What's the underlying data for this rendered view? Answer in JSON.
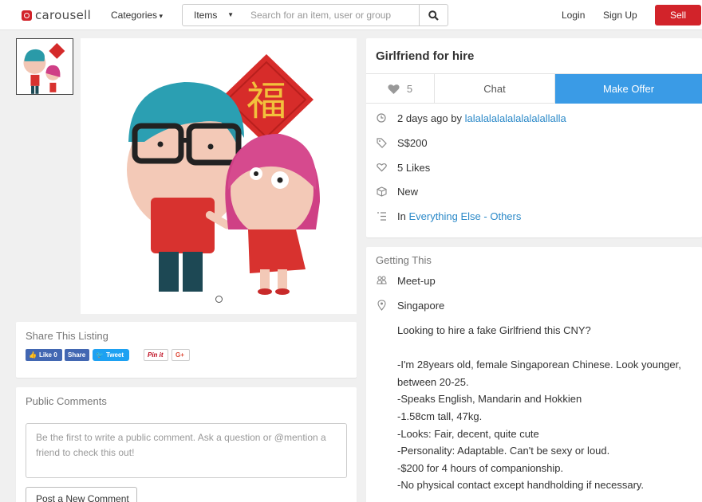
{
  "header": {
    "logo_text": "carousell",
    "categories_label": "Categories",
    "search_scope": "Items",
    "search_placeholder": "Search for an item, user or group",
    "login_label": "Login",
    "signup_label": "Sign Up",
    "sell_label": "Sell",
    "brand_color": "#d2232a"
  },
  "listing": {
    "title": "Girlfriend for hire",
    "likes_count": "5",
    "chat_label": "Chat",
    "offer_label": "Make Offer",
    "posted_text": "2 days ago by",
    "seller": "lalalalalalalalalalallalla",
    "price": "S$200",
    "likes_text": "5 Likes",
    "condition": "New",
    "category_prefix": "In",
    "category": "Everything Else - Others",
    "image_text": "福"
  },
  "share": {
    "title": "Share This Listing",
    "fb_like": "Like 0",
    "fb_share": "Share",
    "tweet": "Tweet",
    "pin": "Pin it",
    "gplus": "G+"
  },
  "comments": {
    "title": "Public Comments",
    "placeholder": "Be the first to write a public comment. Ask a question or @mention a friend to check this out!",
    "post_label": "Post a New Comment"
  },
  "getting": {
    "title": "Getting This",
    "method": "Meet-up",
    "location": "Singapore",
    "description": "Looking to hire a fake Girlfriend this CNY?\n\n-I'm 28years old, female Singaporean Chinese. Look younger, between 20-25.\n-Speaks English, Mandarin and Hokkien\n-1.58cm tall, 47kg.\n-Looks: Fair, decent, quite cute\n-Personality: Adaptable. Can't be sexy or loud.\n-$200 for 4 hours of companionship.\n-No physical contact except handholding if necessary."
  }
}
